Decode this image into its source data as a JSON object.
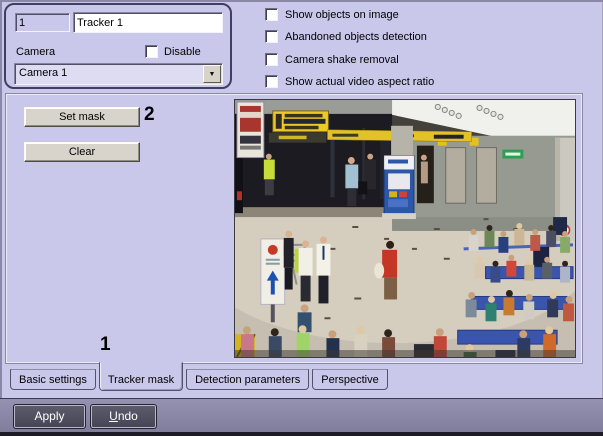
{
  "identity": {
    "id_value": "1",
    "name_value": "Tracker 1",
    "camera_label": "Camera",
    "disable_label": "Disable",
    "camera_selected": "Camera 1"
  },
  "options": {
    "items": [
      {
        "label": "Show objects on image",
        "checked": false
      },
      {
        "label": "Abandoned objects detection",
        "checked": false
      },
      {
        "label": "Camera shake removal",
        "checked": false
      },
      {
        "label": "Show actual video aspect ratio",
        "checked": false
      }
    ]
  },
  "mask_controls": {
    "set_mask_label": "Set mask",
    "clear_label": "Clear"
  },
  "annotations": {
    "set_mask_marker": "2",
    "active_tab_marker": "1"
  },
  "tabs": {
    "items": [
      {
        "label": "Basic settings",
        "active": false
      },
      {
        "label": "Tracker mask",
        "active": true
      },
      {
        "label": "Detection parameters",
        "active": false
      },
      {
        "label": "Perspective",
        "active": false
      }
    ]
  },
  "footer": {
    "apply_label": "Apply",
    "undo_label": "Undo"
  },
  "icons": {
    "dropdown_arrow": "▼"
  },
  "colors": {
    "dialog_bg": "#c9c8ea",
    "group_border": "#3f3f63",
    "button_face": "#d8d4cb",
    "footer_bg": "#8a88a6",
    "footer_button": "#4c4b5c",
    "video_floor": "#c6beb0",
    "sign_yellow": "#e5c222",
    "queue_blue": "#3a55ae"
  }
}
